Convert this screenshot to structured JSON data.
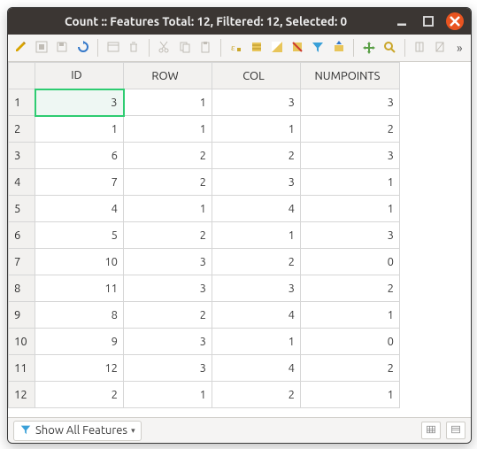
{
  "window": {
    "title": "Count :: Features Total: 12, Filtered: 12, Selected: 0"
  },
  "toolbar": {
    "edit_pencil": "#d9a400",
    "more_label": "»"
  },
  "table": {
    "columns": [
      "ID",
      "ROW",
      "COL",
      "NUMPOINTS"
    ],
    "rows": [
      {
        "n": "1",
        "ID": "3",
        "ROW": "1",
        "COL": "3",
        "NUMPOINTS": "3"
      },
      {
        "n": "2",
        "ID": "1",
        "ROW": "1",
        "COL": "1",
        "NUMPOINTS": "2"
      },
      {
        "n": "3",
        "ID": "6",
        "ROW": "2",
        "COL": "2",
        "NUMPOINTS": "3"
      },
      {
        "n": "4",
        "ID": "7",
        "ROW": "2",
        "COL": "3",
        "NUMPOINTS": "1"
      },
      {
        "n": "5",
        "ID": "4",
        "ROW": "1",
        "COL": "4",
        "NUMPOINTS": "1"
      },
      {
        "n": "6",
        "ID": "5",
        "ROW": "2",
        "COL": "1",
        "NUMPOINTS": "3"
      },
      {
        "n": "7",
        "ID": "10",
        "ROW": "3",
        "COL": "2",
        "NUMPOINTS": "0"
      },
      {
        "n": "8",
        "ID": "11",
        "ROW": "3",
        "COL": "3",
        "NUMPOINTS": "2"
      },
      {
        "n": "9",
        "ID": "8",
        "ROW": "2",
        "COL": "4",
        "NUMPOINTS": "1"
      },
      {
        "n": "10",
        "ID": "9",
        "ROW": "3",
        "COL": "1",
        "NUMPOINTS": "0"
      },
      {
        "n": "11",
        "ID": "12",
        "ROW": "3",
        "COL": "4",
        "NUMPOINTS": "2"
      },
      {
        "n": "12",
        "ID": "2",
        "ROW": "1",
        "COL": "2",
        "NUMPOINTS": "1"
      }
    ],
    "selected_cell": {
      "row": 0,
      "col": 0
    }
  },
  "statusbar": {
    "filter_label": "Show All Features"
  }
}
